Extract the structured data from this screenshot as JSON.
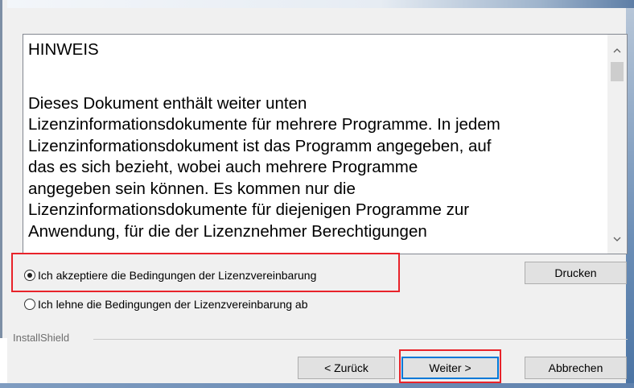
{
  "license": {
    "heading": "HINWEIS",
    "lines": [
      "Dieses Dokument enthält weiter unten",
      "Lizenzinformationsdokumente für mehrere Programme. In jedem",
      "Lizenzinformationsdokument ist das Programm angegeben, auf",
      "das es sich bezieht, wobei auch mehrere Programme",
      "angegeben sein können. Es kommen nur die",
      "Lizenzinformationsdokumente für diejenigen Programme zur",
      "Anwendung, für die der Lizenznehmer Berechtigungen"
    ]
  },
  "scrollbar": {
    "up_icon": "▲",
    "down_icon": "▼"
  },
  "options": {
    "accept_label": "Ich akzeptiere die Bedingungen der Lizenzvereinbarung",
    "decline_label": "Ich lehne die Bedingungen der Lizenzvereinbarung ab",
    "selected": "accept"
  },
  "buttons": {
    "print": "Drucken",
    "back": "< Zurück",
    "next": "Weiter >",
    "cancel": "Abbrechen"
  },
  "footer": {
    "group_label": "InstallShield"
  },
  "colors": {
    "highlight": "#e8232a",
    "focus": "#0078d7"
  }
}
